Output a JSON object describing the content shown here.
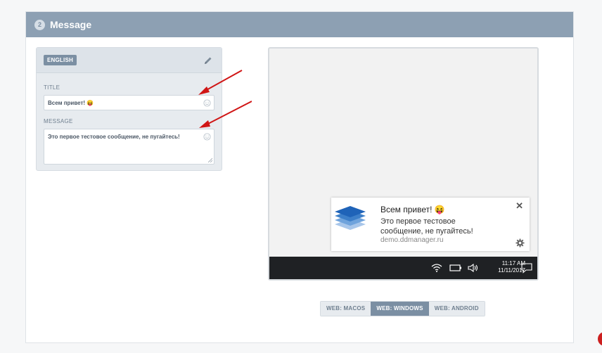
{
  "section": {
    "step": "2",
    "title": "Message"
  },
  "editor": {
    "language": "ENGLISH",
    "title_label": "TITLE",
    "title_value": "Всем привет! 😝",
    "message_label": "MESSAGE",
    "message_value": "Это первое тестовое сообщение, не пугайтесь!"
  },
  "notification": {
    "title": "Всем привет! 😝",
    "body": "Это первое тестовое сообщение, не пугайтесь!",
    "domain": "demo.ddmanager.ru",
    "close": "✕"
  },
  "taskbar": {
    "time": "11:17 AM",
    "date": "11/11/2017"
  },
  "platform_tabs": [
    {
      "label": "WEB: MACOS"
    },
    {
      "label": "WEB: WINDOWS",
      "active": true
    },
    {
      "label": "WEB: ANDROID"
    }
  ],
  "colors": {
    "header": "#8da0b3",
    "accent": "#7b8fa3",
    "arrow": "#d01515"
  }
}
